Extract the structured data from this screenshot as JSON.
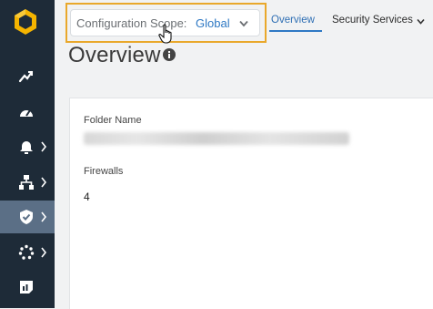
{
  "sidebar": {
    "items": [
      {
        "icon": "activity-icon",
        "has_chevron": false
      },
      {
        "icon": "dashboard-icon",
        "has_chevron": false
      },
      {
        "icon": "alert-bell-icon",
        "has_chevron": true
      },
      {
        "icon": "network-hierarchy-icon",
        "has_chevron": true
      },
      {
        "icon": "shield-check-icon",
        "has_chevron": true,
        "active": true
      },
      {
        "icon": "settings-dots-icon",
        "has_chevron": true
      },
      {
        "icon": "report-icon",
        "has_chevron": false
      }
    ]
  },
  "scope": {
    "label": "Configuration Scope:",
    "value": "Global"
  },
  "tabs": [
    {
      "label": "Overview",
      "active": true
    },
    {
      "label": "Security Services",
      "dropdown": true
    }
  ],
  "page": {
    "title": "Overview"
  },
  "details": {
    "folder_label": "Folder Name",
    "firewalls_label": "Firewalls",
    "firewalls_value": "4"
  },
  "colors": {
    "sidebar_bg": "#1e2b38",
    "active_nav": "#5b6f86",
    "logo_yellow": "#f5b400",
    "highlight_border": "#e9a82b",
    "link_blue": "#2f79c4"
  }
}
